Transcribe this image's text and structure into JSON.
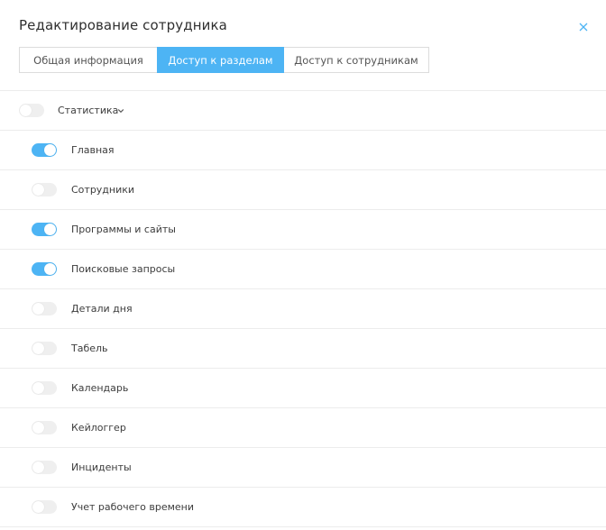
{
  "dialog": {
    "title": "Редактирование сотрудника"
  },
  "tabs": [
    {
      "label": "Общая информация",
      "active": false
    },
    {
      "label": "Доступ к разделам",
      "active": true
    },
    {
      "label": "Доступ к сотрудникам",
      "active": false
    }
  ],
  "group": {
    "label": "Статистика",
    "enabled": false,
    "expanded": true
  },
  "items": [
    {
      "label": "Главная",
      "enabled": true
    },
    {
      "label": "Сотрудники",
      "enabled": false
    },
    {
      "label": "Программы и сайты",
      "enabled": true
    },
    {
      "label": "Поисковые запросы",
      "enabled": true
    },
    {
      "label": "Детали дня",
      "enabled": false
    },
    {
      "label": "Табель",
      "enabled": false
    },
    {
      "label": "Календарь",
      "enabled": false
    },
    {
      "label": "Кейлоггер",
      "enabled": false
    },
    {
      "label": "Инциденты",
      "enabled": false
    },
    {
      "label": "Учет рабочего времени",
      "enabled": false
    }
  ],
  "colors": {
    "accent": "#4db4f4",
    "toggle_off": "#efefef",
    "border": "#ececec"
  }
}
